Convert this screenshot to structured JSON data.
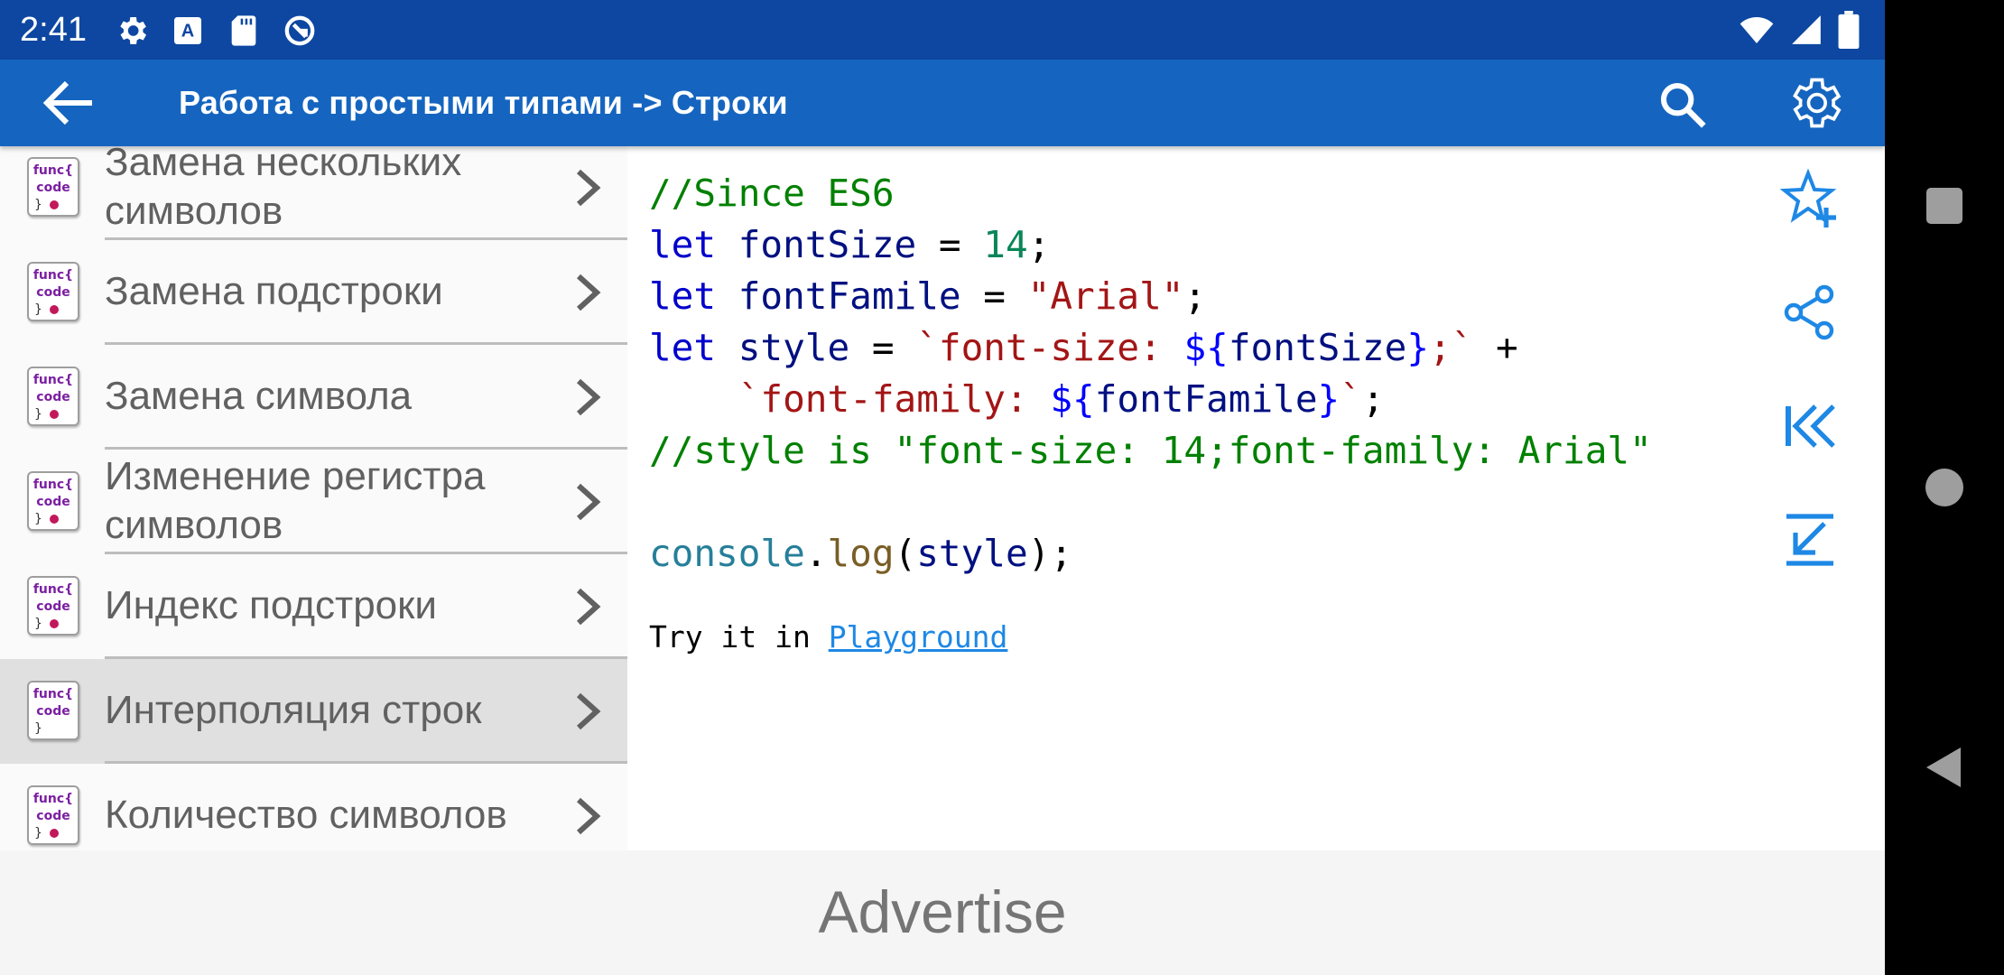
{
  "status_bar": {
    "time": "2:41",
    "left_icons": [
      "gear-icon",
      "font-a-icon",
      "sd-card-icon",
      "sync-icon"
    ],
    "right_icons": [
      "wifi-icon",
      "signal-icon",
      "battery-icon"
    ]
  },
  "app_bar": {
    "title": "Работа с простыми типами -> Строки",
    "icons": [
      "arrow-back-icon",
      "search-icon",
      "settings-icon"
    ]
  },
  "list": {
    "item_icon": {
      "line1": "func{",
      "line2": "code",
      "line3": "}"
    },
    "items": [
      {
        "label": "Замена нескольких символов",
        "active": false
      },
      {
        "label": "Замена подстроки",
        "active": false
      },
      {
        "label": "Замена символа",
        "active": false
      },
      {
        "label": "Изменение регистра символов",
        "active": false
      },
      {
        "label": "Индекс подстроки",
        "active": false
      },
      {
        "label": "Интерполяция строк",
        "active": true
      },
      {
        "label": "Количество символов",
        "active": false
      }
    ]
  },
  "code_tokens": {
    "comment1": "//Since ES6",
    "let": "let",
    "fontSize": "fontSize",
    "eq": " = ",
    "num14": "14",
    "semi": ";",
    "fontFamile": "fontFamile",
    "arial_str": "\"Arial\"",
    "style": "style",
    "tmpl1_open": "`font-size: ",
    "tmpl_expr_open": "${",
    "tmpl_expr_close": "}",
    "tmpl1_close": ";`",
    "plus": " +",
    "indent": "    ",
    "tmpl2_open": "`font-family: ",
    "tmpl2_close": "`",
    "comment2": "//style is \"font-size: 14;font-family: Arial\"",
    "console": "console",
    "dot": ".",
    "log": "log",
    "paren_open": "(",
    "paren_close": ")"
  },
  "try_it": {
    "prefix": "Try it in ",
    "link": "Playground"
  },
  "side_actions": [
    "star-add-icon",
    "share-icon",
    "skip-to-start-icon",
    "arrow-down-left-icon"
  ],
  "advertisement": {
    "label": "Advertise"
  },
  "colors": {
    "status_bar": "#0d47a1",
    "app_bar": "#1565c0",
    "accent_icon": "#1e88e5",
    "comment": "#008000",
    "keyword": "#0000cc",
    "string": "#a31515"
  }
}
